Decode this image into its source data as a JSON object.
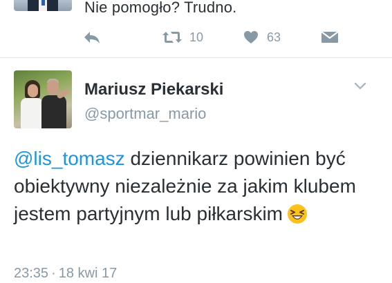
{
  "previous_tweet": {
    "text": "Nie pomogło? Trudno.",
    "retweet_count": "10",
    "like_count": "63",
    "icons": [
      "reply-icon",
      "retweet-icon",
      "heart-icon",
      "direct-message-icon"
    ]
  },
  "tweet": {
    "display_name": "Mariusz Piekarski",
    "handle": "@sportmar_mario",
    "mention": "@lis_tomasz",
    "text_after_mention": " dziennikarz powinien być obiektywny niezależnie za jakim klubem jestem partyjnym lub piłkarskim",
    "emoji": "grinning-squinting-emoji",
    "time": "23:35",
    "separator": "·",
    "date": "18 kwi 17"
  },
  "colors": {
    "text": "#292f33",
    "muted": "#8899a6",
    "link": "#1b95e0",
    "divider": "#e1e8ed"
  }
}
